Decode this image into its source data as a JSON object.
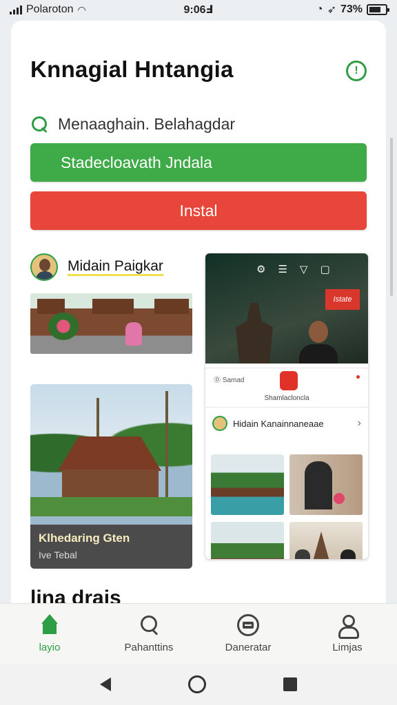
{
  "status_bar": {
    "carrier": "Polaroton",
    "time": "9:06Ⅎ",
    "battery": "73%",
    "icons": [
      "signal-icon",
      "wifi-icon",
      "alarm-icon",
      "location-icon",
      "battery-icon"
    ]
  },
  "app": {
    "title": "Knnagial Hntangia",
    "info_icon": "info-icon"
  },
  "search": {
    "value": "Menaaghain. Belahagdar",
    "icon": "search-icon"
  },
  "buttons": {
    "primary_label": "Stadecloavath Jndala",
    "install_label": "Instal"
  },
  "feed": {
    "left": {
      "profile_name": "Midain Paigkar",
      "caption_title": "Klhedaring Gten",
      "caption_sub": "Ive Tebal"
    },
    "right": {
      "hero_badge": "Istate",
      "mid_left_label": "Ⓓ Samad",
      "mid_caption": "Shamlacloncla",
      "sub_profile_name": "Hidain Kanainnaneaae"
    },
    "section_heading": "lina drais"
  },
  "bottom_nav": {
    "items": [
      {
        "label": "layio",
        "icon": "home-icon",
        "active": true
      },
      {
        "label": "Pahanttins",
        "icon": "search-icon",
        "active": false
      },
      {
        "label": "Daneratar",
        "icon": "calendar-icon",
        "active": false
      },
      {
        "label": "Limjas",
        "icon": "profile-icon",
        "active": false
      }
    ]
  },
  "colors": {
    "accent_green": "#3faa48",
    "install_red": "#e8463a",
    "background": "#eceff1"
  }
}
